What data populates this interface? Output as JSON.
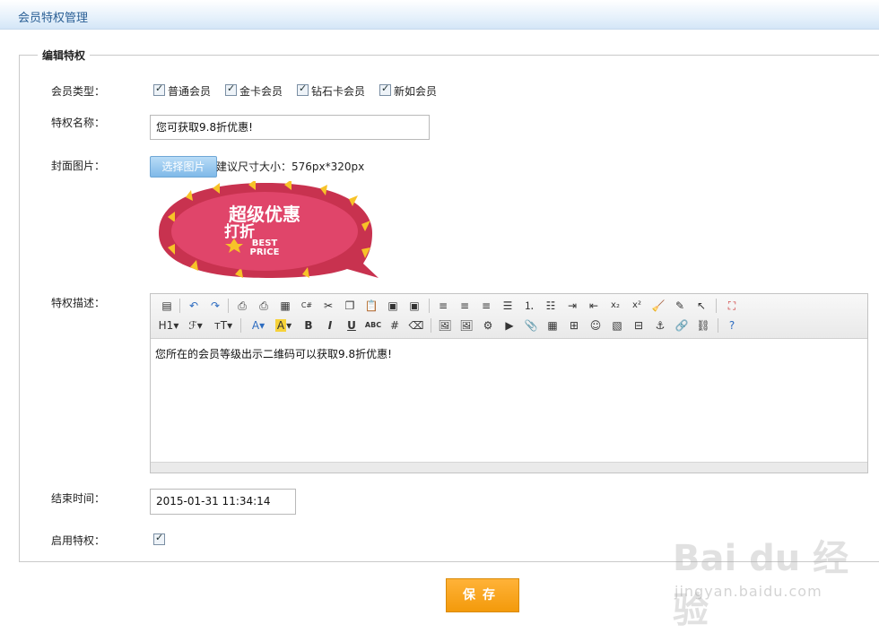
{
  "header": {
    "title": "会员特权管理"
  },
  "section": {
    "legend": "编辑特权"
  },
  "member_type": {
    "label": "会员类型：",
    "options": [
      {
        "label": "普通会员",
        "checked": true
      },
      {
        "label": "金卡会员",
        "checked": true
      },
      {
        "label": "钻石卡会员",
        "checked": true
      },
      {
        "label": "新如会员",
        "checked": true
      }
    ]
  },
  "privilege_name": {
    "label": "特权名称：",
    "value": "您可获取9.8折优惠!"
  },
  "cover": {
    "label": "封面图片：",
    "button": "选择图片",
    "hint": "建议尺寸大小：576px*320px",
    "image_text": {
      "line1": "超级优惠",
      "line2": "打折",
      "badge1": "BEST",
      "badge2": "PRICE"
    }
  },
  "description": {
    "label": "特权描述：",
    "content": "您所在的会员等级出示二维码可以获取9.8折优惠!",
    "toolbar_row1": [
      "source-icon",
      "undo-icon",
      "redo-icon",
      "preview-icon",
      "print-icon",
      "template-icon",
      "code-icon",
      "cut-icon",
      "copy-icon",
      "paste-icon",
      "paste-text-icon",
      "paste-word-icon",
      "align-left-icon",
      "align-center-icon",
      "align-right-icon",
      "align-justify-icon",
      "ordered-list-icon",
      "unordered-list-icon",
      "indent-icon",
      "outdent-icon",
      "subscript-icon",
      "superscript-icon",
      "clear-format-icon",
      "select-all-icon",
      "cursor-icon",
      "fullscreen-icon"
    ],
    "toolbar_row2": [
      "heading-icon",
      "font-family-icon",
      "font-size-icon",
      "font-color-icon",
      "highlight-icon",
      "bold-icon",
      "italic-icon",
      "underline-icon",
      "strikethrough-icon",
      "hr-icon",
      "eraser-icon",
      "image-upload-icon",
      "multi-image-icon",
      "flash-icon",
      "media-icon",
      "attach-icon",
      "table-icon",
      "code-insert-icon",
      "emoticon-icon",
      "image-icon",
      "pagebreak-icon",
      "anchor-icon",
      "link-icon",
      "unlink-icon",
      "help-icon"
    ],
    "labels": {
      "heading": "H1",
      "font": "ℱ",
      "size": "тT",
      "fontcolor": "A",
      "highlight": "A",
      "bold": "B",
      "italic": "I",
      "underline": "U",
      "strike": "ABC",
      "sub": "x₂",
      "sup": "x²"
    }
  },
  "end_time": {
    "label": "结束时间：",
    "value": "2015-01-31 11:34:14"
  },
  "enable": {
    "label": "启用特权：",
    "checked": true
  },
  "save": {
    "label": "保存"
  },
  "watermark": {
    "logo": "Bai du 经验",
    "url": "jingyan.baidu.com"
  },
  "colors": {
    "accent": "#f39a0b",
    "title": "#2a5f95",
    "choose_button": "#7fb9e8"
  }
}
